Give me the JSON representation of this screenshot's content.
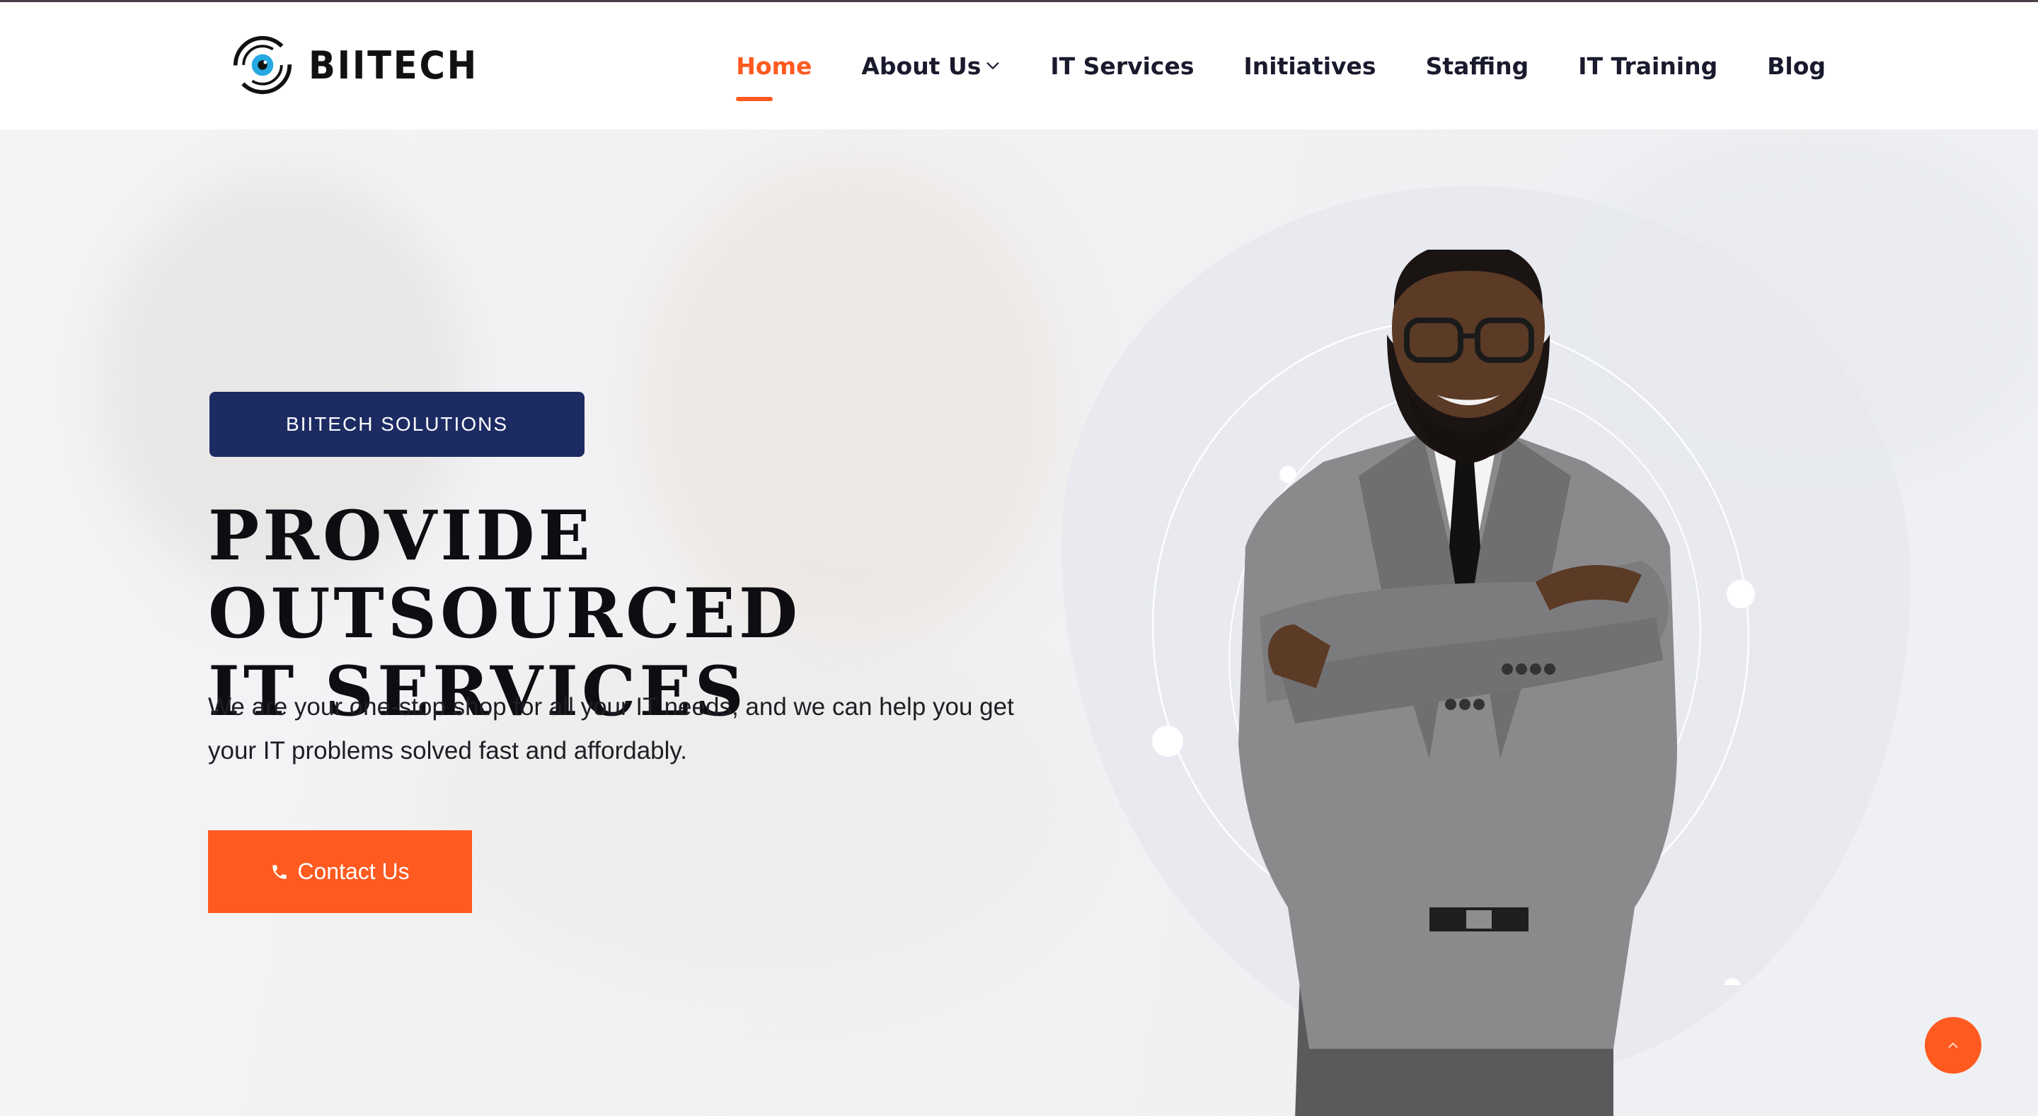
{
  "brand": {
    "name": "BIITECH",
    "accent_color": "#ff5a1f",
    "navy_color": "#1d2b63"
  },
  "nav": {
    "items": [
      {
        "label": "Home",
        "active": true
      },
      {
        "label": "About Us",
        "has_dropdown": true
      },
      {
        "label": "IT Services"
      },
      {
        "label": "Initiatives"
      },
      {
        "label": "Staffing"
      },
      {
        "label": "IT Training"
      },
      {
        "label": "Blog"
      }
    ]
  },
  "hero": {
    "badge": "BIITECH SOLUTIONS",
    "headline_line1": "PROVIDE OUTSOURCED",
    "headline_line2": "IT SERVICES",
    "description_line1": "We are your one-stop shop for all your IT needs, and we can help you get",
    "description_line2": "your IT problems solved fast and affordably.",
    "cta_label": "Contact Us",
    "cta_icon": "phone-icon"
  },
  "icons": {
    "logo": "eye-logo-icon",
    "dropdown": "chevron-down-icon",
    "scroll_top": "chevron-up-icon"
  }
}
